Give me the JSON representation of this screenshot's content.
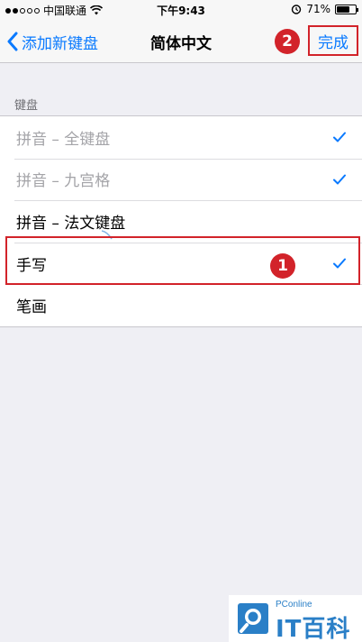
{
  "status_bar": {
    "carrier": "中国联通",
    "time": "下午9:43",
    "battery": "71%",
    "battery_level": 0.71,
    "signal_dots_filled": 2,
    "signal_dots_total": 5,
    "icons": [
      "wifi-icon",
      "alarm-icon",
      "battery-icon"
    ]
  },
  "nav": {
    "back_label": "添加新键盘",
    "title": "简体中文",
    "done_label": "完成"
  },
  "annotations": {
    "badge_1": "1",
    "badge_2": "2",
    "color": "#d2232a"
  },
  "section": {
    "header": "键盘",
    "items": [
      {
        "label": "拼音 – 全键盘",
        "checked": true,
        "disabled": true
      },
      {
        "label": "拼音 – 九宫格",
        "checked": true,
        "disabled": true
      },
      {
        "label": "拼音 – 法文键盘",
        "checked": false,
        "disabled": false
      },
      {
        "label": "手写",
        "checked": true,
        "disabled": false
      },
      {
        "label": "笔画",
        "checked": false,
        "disabled": false
      }
    ]
  },
  "watermark": {
    "small_text": "PConline",
    "big_text": "IT百科"
  },
  "colors": {
    "accent": "#0a7aff",
    "annotation": "#d2232a",
    "background": "#efeff4"
  }
}
